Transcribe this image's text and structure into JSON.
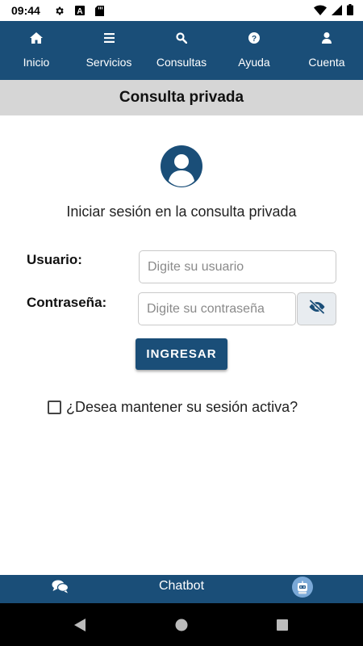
{
  "status_bar": {
    "time": "09:44",
    "icons": [
      "gear-icon",
      "font-a-icon",
      "sd-card-icon",
      "wifi-icon",
      "signal-icon",
      "battery-icon"
    ]
  },
  "top_nav": {
    "items": [
      {
        "label": "Inicio",
        "icon": "home-icon"
      },
      {
        "label": "Servicios",
        "icon": "menu-icon"
      },
      {
        "label": "Consultas",
        "icon": "search-icon"
      },
      {
        "label": "Ayuda",
        "icon": "help-icon"
      },
      {
        "label": "Cuenta",
        "icon": "user-icon"
      }
    ]
  },
  "page": {
    "title": "Consulta privada",
    "subtitle": "Iniciar sesión en la consulta privada"
  },
  "form": {
    "user_label": "Usuario:",
    "user_placeholder": "Digite su usuario",
    "user_value": "",
    "password_label": "Contraseña:",
    "password_placeholder": "Digite su contraseña",
    "password_value": "",
    "submit_label": "INGRESAR",
    "keep_session_label": "¿Desea mantener su sesión activa?",
    "keep_session_checked": false
  },
  "chatbot": {
    "label": "Chatbot"
  },
  "colors": {
    "primary": "#1a4e78",
    "title_bar": "#d6d6d6"
  }
}
